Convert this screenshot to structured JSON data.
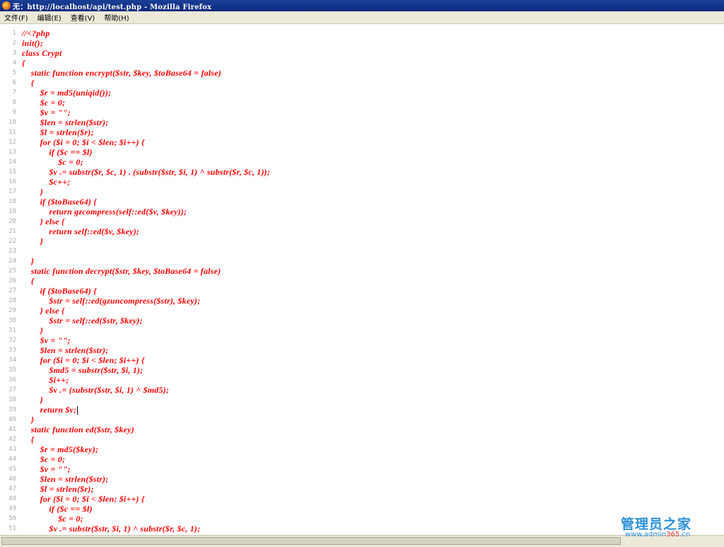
{
  "window": {
    "title": "无：http://localhost/api/test.php - Mozilla Firefox"
  },
  "menu": {
    "items": [
      "文件(F)",
      "编辑(E)",
      "查看(V)",
      "帮助(H)"
    ]
  },
  "editor": {
    "text_color": "#ff0000",
    "lines": [
      {
        "no": "1",
        "text": "//<?php"
      },
      {
        "no": "2",
        "text": "init();"
      },
      {
        "no": "3",
        "text": "class Crypt"
      },
      {
        "no": "4",
        "text": "{"
      },
      {
        "no": "5",
        "text": "    static function encrypt($str, $key, $toBase64 = false)"
      },
      {
        "no": "6",
        "text": "    {"
      },
      {
        "no": "7",
        "text": "        $r = md5(uniqid());"
      },
      {
        "no": "8",
        "text": "        $c = 0;"
      },
      {
        "no": "9",
        "text": "        $v = \"\";"
      },
      {
        "no": "10",
        "text": "        $len = strlen($str);"
      },
      {
        "no": "11",
        "text": "        $l = strlen($r);"
      },
      {
        "no": "12",
        "text": "        for ($i = 0; $i < $len; $i++) {"
      },
      {
        "no": "13",
        "text": "            if ($c == $l)"
      },
      {
        "no": "14",
        "text": "                $c = 0;"
      },
      {
        "no": "15",
        "text": "            $v .= substr($r, $c, 1) . (substr($str, $i, 1) ^ substr($r, $c, 1));"
      },
      {
        "no": "16",
        "text": "            $c++;"
      },
      {
        "no": "17",
        "text": "        }"
      },
      {
        "no": "18",
        "text": "        if ($toBase64) {"
      },
      {
        "no": "19",
        "text": "            return gzcompress(self::ed($v, $key));"
      },
      {
        "no": "20",
        "text": "        } else {"
      },
      {
        "no": "21",
        "text": "            return self::ed($v, $key);"
      },
      {
        "no": "22",
        "text": "        }"
      },
      {
        "no": "23",
        "text": ""
      },
      {
        "no": "24",
        "text": "    }"
      },
      {
        "no": "25",
        "text": "    static function decrypt($str, $key, $toBase64 = false)"
      },
      {
        "no": "26",
        "text": "    {"
      },
      {
        "no": "27",
        "text": "        if ($toBase64) {"
      },
      {
        "no": "28",
        "text": "            $str = self::ed(gzuncompress($str), $key);"
      },
      {
        "no": "29",
        "text": "        } else {"
      },
      {
        "no": "30",
        "text": "            $str = self::ed($str, $key);"
      },
      {
        "no": "31",
        "text": "        }"
      },
      {
        "no": "32",
        "text": "        $v = \"\";"
      },
      {
        "no": "33",
        "text": "        $len = strlen($str);"
      },
      {
        "no": "34",
        "text": "        for ($i = 0; $i < $len; $i++) {"
      },
      {
        "no": "35",
        "text": "            $md5 = substr($str, $i, 1);"
      },
      {
        "no": "36",
        "text": "            $i++;"
      },
      {
        "no": "37",
        "text": "            $v .= (substr($str, $i, 1) ^ $md5);"
      },
      {
        "no": "38",
        "text": "        }"
      },
      {
        "no": "39",
        "text": "        return $v;"
      },
      {
        "no": "40",
        "text": "    }"
      },
      {
        "no": "41",
        "text": "    static function ed($str, $key)"
      },
      {
        "no": "42",
        "text": "    {"
      },
      {
        "no": "43",
        "text": "        $r = md5($key);"
      },
      {
        "no": "44",
        "text": "        $c = 0;"
      },
      {
        "no": "45",
        "text": "        $v = \"\";"
      },
      {
        "no": "46",
        "text": "        $len = strlen($str);"
      },
      {
        "no": "47",
        "text": "        $l = strlen($r);"
      },
      {
        "no": "48",
        "text": "        for ($i = 0; $i < $len; $i++) {"
      },
      {
        "no": "49",
        "text": "            if ($c == $l)"
      },
      {
        "no": "50",
        "text": "                $c = 0;"
      },
      {
        "no": "51",
        "text": "            $v .= substr($str, $i, 1) ^ substr($r, $c, 1);"
      }
    ]
  },
  "watermark": {
    "name": "管理员之家",
    "url_prefix": "www.admin",
    "url_number": "365",
    "url_suffix": ".cn"
  }
}
